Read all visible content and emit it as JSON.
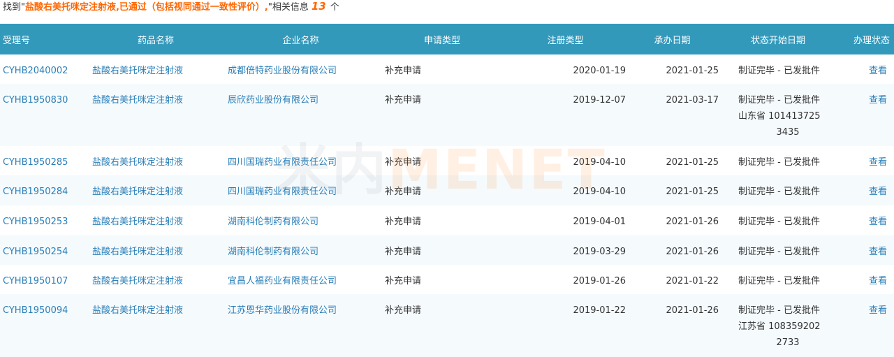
{
  "summary": {
    "prefix": "找到\"",
    "query": "盐酸右美托咪定注射液,已通过（包括视同通过一致性评价）,",
    "mid": "\"相关信息",
    "count": "13",
    "suffix": "个"
  },
  "watermark": {
    "cn": "米内",
    "en": "MENET"
  },
  "table": {
    "headers": {
      "acceptance_no": "受理号",
      "drug_name": "药品名称",
      "company": "企业名称",
      "apply_type": "申请类型",
      "reg_type": "注册类型",
      "undertake_date": "承办日期",
      "status_date": "状态开始日期",
      "handle_status": "办理状态"
    },
    "rows": [
      {
        "acceptance_no": "CYHB2040002",
        "drug_name": "盐酸右美托咪定注射液",
        "company": "成都倍特药业股份有限公司",
        "apply_type": "补充申请",
        "reg_type": "2020-01-19",
        "undertake_date": "2021-01-25",
        "status": "制证完毕 - 已发批件",
        "extra1": "",
        "extra2": "",
        "action": "查看"
      },
      {
        "acceptance_no": "CYHB1950830",
        "drug_name": "盐酸右美托咪定注射液",
        "company": "辰欣药业股份有限公司",
        "apply_type": "补充申请",
        "reg_type": "2019-12-07",
        "undertake_date": "2021-03-17",
        "status": "制证完毕 - 已发批件",
        "extra1": "山东省 101413725",
        "extra2": "3435",
        "action": "查看"
      },
      {
        "acceptance_no": "CYHB1950285",
        "drug_name": "盐酸右美托咪定注射液",
        "company": "四川国瑞药业有限责任公司",
        "apply_type": "补充申请",
        "reg_type": "2019-04-10",
        "undertake_date": "2021-01-25",
        "status": "制证完毕 - 已发批件",
        "extra1": "",
        "extra2": "",
        "action": "查看"
      },
      {
        "acceptance_no": "CYHB1950284",
        "drug_name": "盐酸右美托咪定注射液",
        "company": "四川国瑞药业有限责任公司",
        "apply_type": "补充申请",
        "reg_type": "2019-04-10",
        "undertake_date": "2021-01-25",
        "status": "制证完毕 - 已发批件",
        "extra1": "",
        "extra2": "",
        "action": "查看"
      },
      {
        "acceptance_no": "CYHB1950253",
        "drug_name": "盐酸右美托咪定注射液",
        "company": "湖南科伦制药有限公司",
        "apply_type": "补充申请",
        "reg_type": "2019-04-01",
        "undertake_date": "2021-01-26",
        "status": "制证完毕 - 已发批件",
        "extra1": "",
        "extra2": "",
        "action": "查看"
      },
      {
        "acceptance_no": "CYHB1950254",
        "drug_name": "盐酸右美托咪定注射液",
        "company": "湖南科伦制药有限公司",
        "apply_type": "补充申请",
        "reg_type": "2019-03-29",
        "undertake_date": "2021-01-26",
        "status": "制证完毕 - 已发批件",
        "extra1": "",
        "extra2": "",
        "action": "查看"
      },
      {
        "acceptance_no": "CYHB1950107",
        "drug_name": "盐酸右美托咪定注射液",
        "company": "宜昌人福药业有限责任公司",
        "apply_type": "补充申请",
        "reg_type": "2019-01-26",
        "undertake_date": "2021-01-22",
        "status": "制证完毕 - 已发批件",
        "extra1": "",
        "extra2": "",
        "action": "查看"
      },
      {
        "acceptance_no": "CYHB1950094",
        "drug_name": "盐酸右美托咪定注射液",
        "company": "江苏恩华药业股份有限公司",
        "apply_type": "补充申请",
        "reg_type": "2019-01-22",
        "undertake_date": "2021-01-26",
        "status": "制证完毕 - 已发批件",
        "extra1": "江苏省 108359202",
        "extra2": "2733",
        "action": "查看"
      }
    ]
  }
}
